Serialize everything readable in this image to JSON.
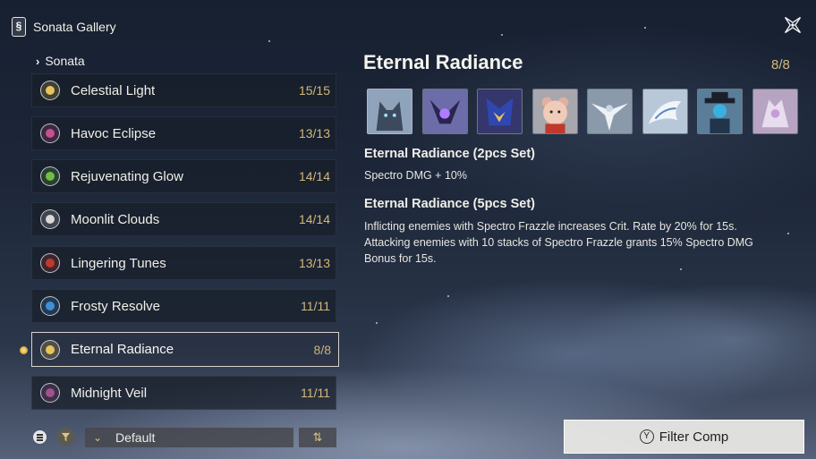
{
  "header": {
    "title": "Sonata Gallery"
  },
  "breadcrumb": {
    "label": "Sonata"
  },
  "sonatas": [
    {
      "name": "Celestial Light",
      "count": "15/15",
      "color": "#e8c45a",
      "icon": "sun-icon"
    },
    {
      "name": "Havoc Eclipse",
      "count": "13/13",
      "color": "#c5518f",
      "icon": "vortex-icon"
    },
    {
      "name": "Rejuvenating Glow",
      "count": "14/14",
      "color": "#6fbf45",
      "icon": "heal-cross-icon"
    },
    {
      "name": "Moonlit Clouds",
      "count": "14/14",
      "color": "#d8d8d8",
      "icon": "cloud-icon"
    },
    {
      "name": "Lingering Tunes",
      "count": "13/13",
      "color": "#c0392b",
      "icon": "crossed-swords-icon"
    },
    {
      "name": "Frosty Resolve",
      "count": "11/11",
      "color": "#3f8fd8",
      "icon": "snowflake-icon"
    },
    {
      "name": "Eternal Radiance",
      "count": "8/8",
      "color": "#e8c45a",
      "icon": "radiance-icon"
    },
    {
      "name": "Midnight Veil",
      "count": "11/11",
      "color": "#a0528c",
      "icon": "veil-icon"
    }
  ],
  "sort": {
    "value": "Default"
  },
  "detail": {
    "title": "Eternal Radiance",
    "count": "8/8",
    "echoes": [
      "echo-wolf",
      "echo-mech-eye",
      "echo-spectro-beast",
      "echo-bear",
      "echo-white-bird",
      "echo-white-dragon",
      "echo-hat-figure",
      "echo-lilac-figure"
    ],
    "set2": {
      "title": "Eternal Radiance (2pcs Set)",
      "text": "Spectro DMG + 10%"
    },
    "set5": {
      "title": "Eternal Radiance (5pcs Set)",
      "line1": "Inflicting enemies with Spectro Frazzle increases Crit. Rate by 20% for 15s.",
      "line2": "Attacking enemies with 10 stacks of Spectro Frazzle grants 15% Spectro DMG",
      "line3": "Bonus for 15s."
    }
  },
  "filter_button": {
    "key": "Y",
    "label": "Filter Comp"
  }
}
